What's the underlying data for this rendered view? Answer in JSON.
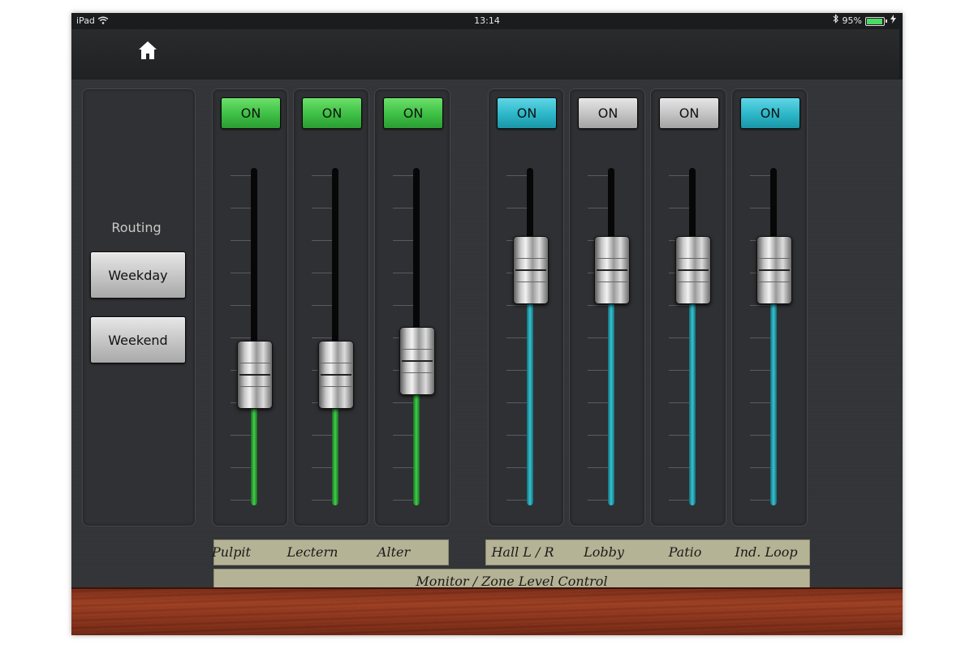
{
  "status_bar": {
    "device": "iPad",
    "time": "13:14",
    "battery": "95%",
    "battery_level": 0.95,
    "icons": [
      "wifi-icon",
      "bluetooth-icon",
      "battery-icon",
      "charging-icon"
    ]
  },
  "header": {
    "home_icon": "home-icon"
  },
  "routing": {
    "label": "Routing",
    "buttons": [
      "Weekday",
      "Weekend"
    ]
  },
  "channels": [
    {
      "name": "Pulpit",
      "on_label": "ON",
      "on_color": "#3dbf44",
      "fill_color": "green",
      "level": 0.39
    },
    {
      "name": "Lectern",
      "on_label": "ON",
      "on_color": "#3dbf44",
      "fill_color": "green",
      "level": 0.39
    },
    {
      "name": "Alter",
      "on_label": "ON",
      "on_color": "#3dbf44",
      "fill_color": "green",
      "level": 0.43
    },
    {
      "name": "Hall L / R",
      "on_label": "ON",
      "on_color": "#2bb6c8",
      "fill_color": "cyan",
      "level": 0.7
    },
    {
      "name": "Lobby",
      "on_label": "ON",
      "on_color": "#c2c2c2",
      "fill_color": "cyan",
      "level": 0.7
    },
    {
      "name": "Patio",
      "on_label": "ON",
      "on_color": "#c2c2c2",
      "fill_color": "cyan",
      "level": 0.7
    },
    {
      "name": "Ind. Loop",
      "on_label": "ON",
      "on_color": "#2bb6c8",
      "fill_color": "cyan",
      "level": 0.7
    }
  ],
  "footer": {
    "title": "Monitor / Zone Level Control"
  }
}
